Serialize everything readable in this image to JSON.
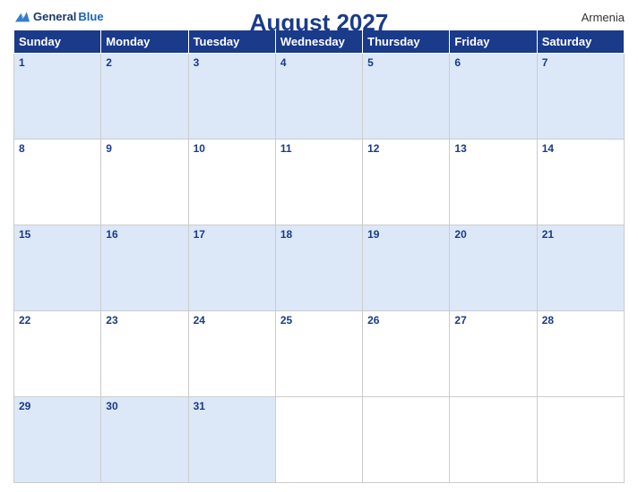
{
  "header": {
    "title": "August 2027",
    "country": "Armenia",
    "logo": {
      "general": "General",
      "blue": "Blue"
    }
  },
  "weekdays": [
    "Sunday",
    "Monday",
    "Tuesday",
    "Wednesday",
    "Thursday",
    "Friday",
    "Saturday"
  ],
  "weeks": [
    [
      1,
      2,
      3,
      4,
      5,
      6,
      7
    ],
    [
      8,
      9,
      10,
      11,
      12,
      13,
      14
    ],
    [
      15,
      16,
      17,
      18,
      19,
      20,
      21
    ],
    [
      22,
      23,
      24,
      25,
      26,
      27,
      28
    ],
    [
      29,
      30,
      31,
      null,
      null,
      null,
      null
    ]
  ]
}
